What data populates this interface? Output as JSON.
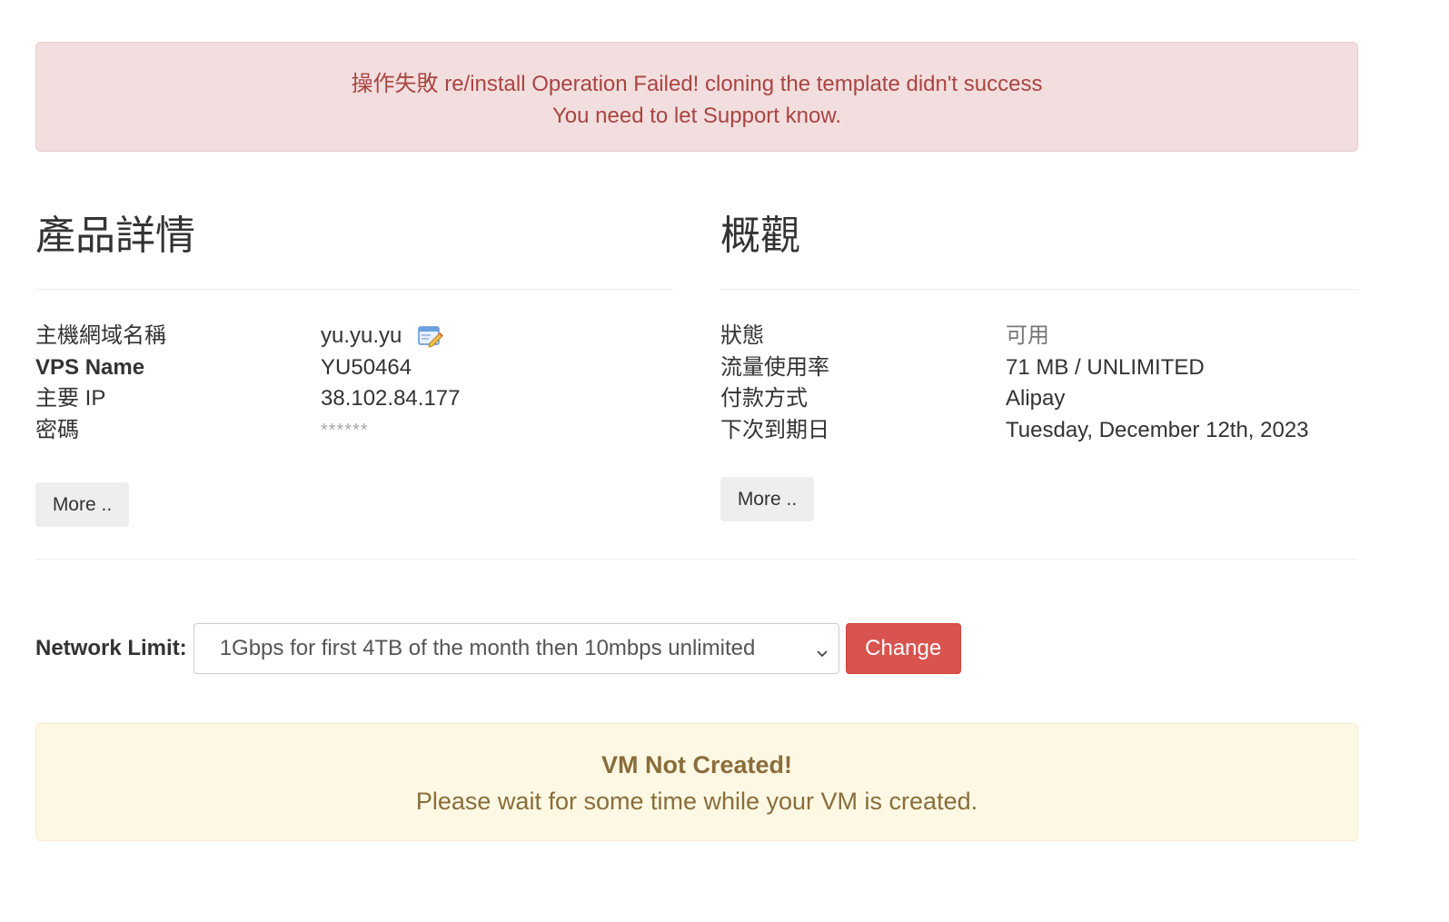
{
  "error_alert": {
    "line1": "操作失敗 re/install Operation Failed! cloning the template didn't success",
    "line2": "You need to let Support know."
  },
  "product_details": {
    "title": "產品詳情",
    "rows": [
      {
        "label": "主機網域名稱",
        "value": "yu.yu.yu"
      },
      {
        "label": "VPS Name",
        "value": "YU50464"
      },
      {
        "label": "主要 IP",
        "value": "38.102.84.177"
      },
      {
        "label": "密碼",
        "value": "******"
      }
    ],
    "more_label": "More .."
  },
  "overview": {
    "title": "概觀",
    "rows": [
      {
        "label": "狀態",
        "value": "可用"
      },
      {
        "label": "流量使用率",
        "value": "71 MB / UNLIMITED"
      },
      {
        "label": "付款方式",
        "value": "Alipay"
      },
      {
        "label": "下次到期日",
        "value": "Tuesday, December 12th, 2023"
      }
    ],
    "more_label": "More .."
  },
  "network": {
    "label": "Network Limit:",
    "selected": "1Gbps for first 4TB of the month then 10mbps unlimited",
    "change_label": "Change"
  },
  "warning_alert": {
    "title": "VM Not Created!",
    "body": "Please wait for some time while your VM is created."
  },
  "colors": {
    "danger_bg": "#f2dede",
    "danger_text": "#a94442",
    "warning_bg": "#fcf8e3",
    "warning_text": "#8a6d3b",
    "change_button": "#d9534f"
  }
}
